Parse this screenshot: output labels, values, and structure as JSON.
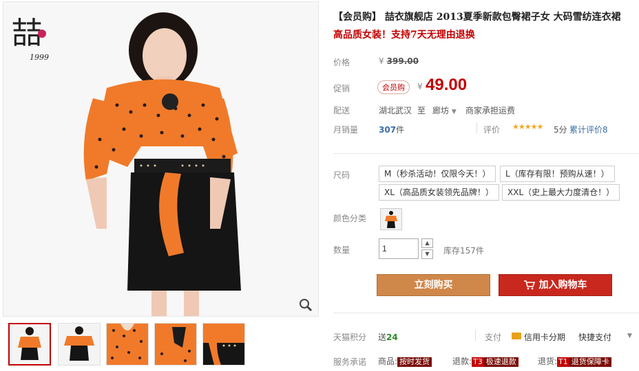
{
  "gallery": {
    "brand_year": "1999",
    "thumbnails": [
      "thumb-1",
      "thumb-2",
      "thumb-3",
      "thumb-4",
      "thumb-5"
    ],
    "active_thumb": 0
  },
  "product": {
    "title": "【会员购】 喆衣旗舰店 2013夏季新款包臀裙子女 大码雪纺连衣裙",
    "subtitle": "高品质女装！支持7天无理由退换",
    "price_label": "价格",
    "currency": "¥",
    "original_price": "399.00",
    "promo_label": "促销",
    "promo_badge": "会员购",
    "promo_price": "49.00",
    "shipping_label": "配送",
    "ship_from": "湖北武汉",
    "ship_to_word": "至",
    "ship_dest": "廊坊",
    "ship_fee": "商家承担运费",
    "monthly_label": "月销量",
    "monthly_sales": "307",
    "monthly_unit": "件",
    "rating_label": "评价",
    "rating_stars": "★★★★★",
    "rating_score": "5分",
    "rating_count_text": "累计评价8"
  },
  "options": {
    "size_label": "尺码",
    "sizes": [
      "M（秒杀活动！仅限今天！）",
      "L（库存有限！预购从速！）",
      "XL（高品质女装领先品牌！）",
      "XXL（史上最大力度清仓！）"
    ],
    "color_label": "颜色分类",
    "qty_label": "数量",
    "qty_value": "1",
    "stock_text": "库存157件"
  },
  "actions": {
    "buy_now": "立刻购买",
    "add_to_cart": "加入购物车"
  },
  "footer": {
    "points_label": "天猫积分",
    "points_prefix": "送",
    "points_value": "24",
    "pay_label": "支付",
    "credit_card": "信用卡分期",
    "quick_pay": "快捷支付",
    "service_label": "服务承诺",
    "s1_prefix": "商品:",
    "s1_tag": "按时发货",
    "s2_prefix": "退款:",
    "s2_code": "T3",
    "s2_tag": "极速退款",
    "s3_prefix": "退货:",
    "s3_code": "T1",
    "s3_tag": "退货保障卡"
  },
  "colors": {
    "accent_red": "#c40000",
    "buy_orange": "#d0874a",
    "cart_red": "#c8281d",
    "link_blue": "#3a6ea5"
  }
}
